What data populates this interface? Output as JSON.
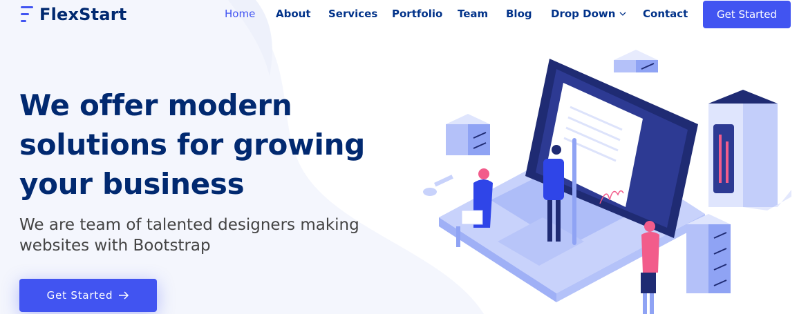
{
  "brand": {
    "name": "FlexStart",
    "accent": "#4154f1",
    "dark": "#012970"
  },
  "nav": {
    "items": [
      {
        "label": "Home",
        "active": true
      },
      {
        "label": "About"
      },
      {
        "label": "Services"
      },
      {
        "label": "Portfolio"
      },
      {
        "label": "Team"
      },
      {
        "label": "Blog"
      },
      {
        "label": "Drop Down",
        "icon": "chevron-down-icon"
      },
      {
        "label": "Contact"
      }
    ],
    "cta_label": "Get Started"
  },
  "hero": {
    "title": "We offer modern solutions for growing your business",
    "subtitle": "We are team of talented designers making websites with Bootstrap",
    "cta_label": "Get Started",
    "cta_icon": "arrow-right-icon"
  }
}
